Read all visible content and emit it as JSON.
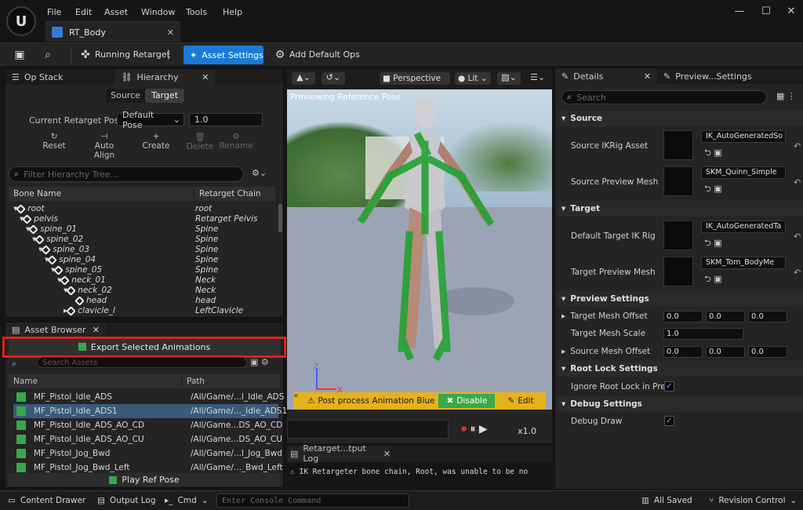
{
  "menu": [
    "File",
    "Edit",
    "Asset",
    "Window",
    "Tools",
    "Help"
  ],
  "doc_tab": "RT_Body",
  "toolbar": {
    "running": "Running Retarget",
    "asset_settings": "Asset Settings",
    "add_default_ops": "Add Default Ops"
  },
  "left": {
    "tabs": [
      "Op Stack",
      "Hierarchy"
    ],
    "source_label": "Source",
    "target_label": "Target",
    "pose_label": "Current Retarget Pose:",
    "pose_value": "Default Pose",
    "pose_blend": "1.0",
    "actions": [
      "Reset",
      "Auto Align",
      "Create",
      "Delete",
      "Rename"
    ],
    "filter_placeholder": "Filter Hierarchy Tree...",
    "col_bone": "Bone Name",
    "col_chain": "Retarget Chain",
    "rows": [
      {
        "bone": "root",
        "chain": "root"
      },
      {
        "bone": "pelvis",
        "chain": "Retarget Pelvis"
      },
      {
        "bone": "spine_01",
        "chain": "Spine"
      },
      {
        "bone": "spine_02",
        "chain": "Spine"
      },
      {
        "bone": "spine_03",
        "chain": "Spine"
      },
      {
        "bone": "spine_04",
        "chain": "Spine"
      },
      {
        "bone": "spine_05",
        "chain": "Spine"
      },
      {
        "bone": "neck_01",
        "chain": "Neck"
      },
      {
        "bone": "neck_02",
        "chain": "Neck"
      },
      {
        "bone": "head",
        "chain": "head"
      },
      {
        "bone": "clavicle_l",
        "chain": "LeftClavicle"
      }
    ]
  },
  "asset_browser": {
    "tab": "Asset Browser",
    "export_button": "Export Selected Animations",
    "search_placeholder": "Search Assets",
    "col_name": "Name",
    "col_path": "Path",
    "rows": [
      {
        "name": "MF_Pistol_Idle_ADS",
        "path": "/All/Game/...l_Idle_ADS"
      },
      {
        "name": "MF_Pistol_Idle_ADS1",
        "path": "/All/Game/..._Idle_ADS1"
      },
      {
        "name": "MF_Pistol_Idle_ADS_AO_CD",
        "path": "/All/Game...DS_AO_CD"
      },
      {
        "name": "MF_Pistol_Idle_ADS_AO_CU",
        "path": "/All/Game...DS_AO_CU"
      },
      {
        "name": "MF_Pistol_Jog_Bwd",
        "path": "/All/Game/...l_Jog_Bwd"
      },
      {
        "name": "MF_Pistol_Jog_Bwd_Left",
        "path": "/All/Game/..._Bwd_Left"
      }
    ],
    "play_ref_pose": "Play Ref Pose"
  },
  "viewport": {
    "perspective": "Perspective",
    "lit": "Lit",
    "overlay": "Previewing Reference Pose",
    "warning": "Post process Animation Bluepr",
    "disable": "Disable",
    "edit": "Edit",
    "speed": "x1.0",
    "axis_z": "Z",
    "axis_x": "X"
  },
  "output": {
    "tab": "Retarget...tput Log",
    "line": "IK Retargeter bone chain, Root, was unable to be no"
  },
  "details": {
    "tabs": [
      "Details",
      "Preview...Settings"
    ],
    "search_placeholder": "Search",
    "source": {
      "header": "Source",
      "ikrig_label": "Source IKRig Asset",
      "ikrig_value": "IK_AutoGeneratedSo",
      "mesh_label": "Source Preview Mesh",
      "mesh_value": "SKM_Quinn_Simple"
    },
    "target": {
      "header": "Target",
      "ikrig_label": "Default Target IK Rig",
      "ikrig_value": "IK_AutoGeneratedTa",
      "mesh_label": "Target Preview Mesh",
      "mesh_value": "SKM_Tom_BodyMe"
    },
    "preview": {
      "header": "Preview Settings",
      "offset_label": "Target Mesh Offset",
      "offset": [
        "0.0",
        "0.0",
        "0.0"
      ],
      "scale_label": "Target Mesh Scale",
      "scale": "1.0",
      "src_offset_label": "Source Mesh Offset",
      "src_offset": [
        "0.0",
        "0.0",
        "0.0"
      ]
    },
    "root_lock": {
      "header": "Root Lock Settings",
      "label": "Ignore Root Lock in Pre..."
    },
    "debug": {
      "header": "Debug Settings",
      "label": "Debug Draw"
    }
  },
  "statusbar": {
    "content_drawer": "Content Drawer",
    "output_log": "Output Log",
    "cmd": "Cmd",
    "console_placeholder": "Enter Console Command",
    "saved": "All Saved",
    "revision": "Revision Control"
  },
  "colors": {
    "accent": "#1a7ad8",
    "highlight_box": "#e0201c",
    "warning": "#e6b21c",
    "green": "#2e9e3a"
  }
}
